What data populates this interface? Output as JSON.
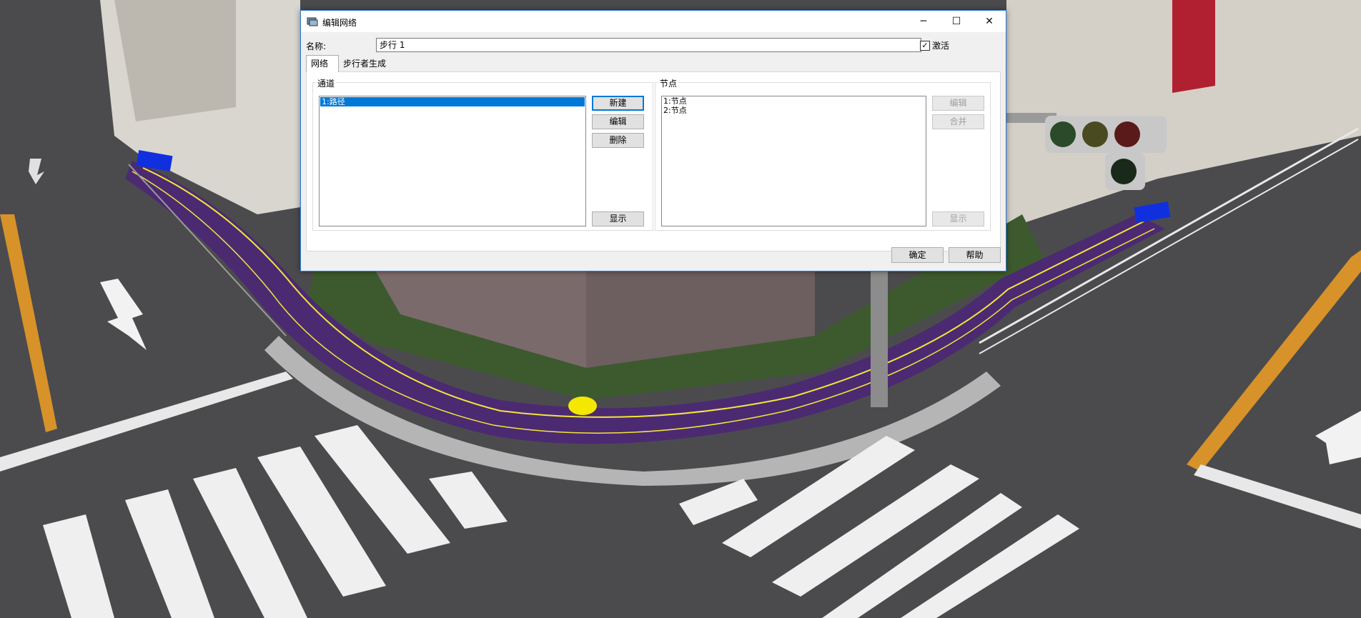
{
  "dialog": {
    "title": "编辑网络",
    "window_controls": {
      "minimize": "─",
      "maximize": "☐",
      "close": "✕"
    },
    "name_label": "名称:",
    "name_value": "步行 1",
    "activate_label": "激活",
    "activate_checked": "✓",
    "tabs": [
      {
        "label": "网络"
      },
      {
        "label": "步行者生成"
      }
    ],
    "channels": {
      "title": "通道",
      "items": [
        "1:路径"
      ],
      "buttons": {
        "new": "新建",
        "edit": "编辑",
        "delete": "删除",
        "show": "显示"
      }
    },
    "nodes": {
      "title": "节点",
      "items": [
        "1:节点",
        "2:节点"
      ],
      "buttons": {
        "edit": "编辑",
        "merge": "合并",
        "show": "显示"
      }
    },
    "footer": {
      "ok": "确定",
      "help": "帮助"
    }
  },
  "colors": {
    "accent": "#0078d7",
    "walkway": "#4b2a72",
    "path_line": "#f2e63a",
    "node_marker": "#1030e0"
  }
}
